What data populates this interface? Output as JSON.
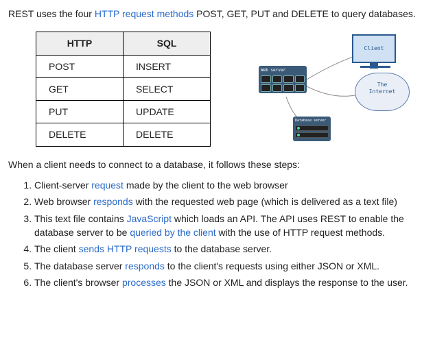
{
  "intro": {
    "p1": "REST uses the four ",
    "link1": "HTTP request methods",
    "p2": " POST, GET, PUT and DELETE to query databases."
  },
  "table": {
    "headers": [
      "HTTP",
      "SQL"
    ],
    "rows": [
      [
        "POST",
        "INSERT"
      ],
      [
        "GET",
        "SELECT"
      ],
      [
        "PUT",
        "UPDATE"
      ],
      [
        "DELETE",
        "DELETE"
      ]
    ]
  },
  "diagram": {
    "client_label": "Client",
    "cloud_line1": "The",
    "cloud_line2": "Internet",
    "webserver_label": "Web server",
    "dbserver_label": "Database server"
  },
  "subhead": "When a client needs to connect to a database, it follows these steps:",
  "steps": [
    {
      "t1": "Client-server ",
      "l": "request",
      "t2": " made by the client to the web browser"
    },
    {
      "t1": "Web browser ",
      "l": "responds",
      "t2": " with the requested web page (which is delivered as a text file)"
    },
    {
      "t1": "This text file contains ",
      "l": "JavaScript",
      "t2": " which loads an API. The API uses REST to enable the database server to be ",
      "l2": "queried by the client",
      "t3": " with the use of HTTP request methods."
    },
    {
      "t1": "The client ",
      "l": "sends HTTP requests",
      "t2": " to the database server."
    },
    {
      "t1": "The database server ",
      "l": "responds",
      "t2": " to the client's requests using either JSON or XML."
    },
    {
      "t1": "The client's browser ",
      "l": "processes",
      "t2": " the JSON or XML and displays the response to the user."
    }
  ]
}
